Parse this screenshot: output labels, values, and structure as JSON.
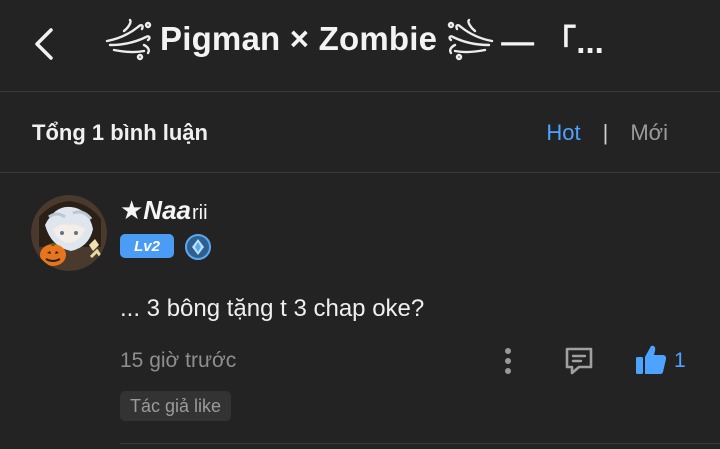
{
  "header": {
    "title": "Pigman × Zombie",
    "title_tail": "— 「...",
    "back_icon": "chevron-left-icon",
    "decor_icon": "swirl-ornament-icon"
  },
  "comments_bar": {
    "count_label": "Tổng 1 bình luận",
    "sort_hot": "Hot",
    "separator": "|",
    "sort_new": "Mới",
    "active_color": "#4da3ff"
  },
  "comment": {
    "user_name": "★Naa",
    "user_name_suffix": "rii",
    "level_badge": "Lv2",
    "level_color": "#4b9cf5",
    "verify_icon": "diamond-badge-icon",
    "text": "... 3 bông tặng t 3 chap oke?",
    "time": "15 giờ trước",
    "more_icon": "more-vertical-icon",
    "reply_icon": "comment-icon",
    "like_icon": "thumbs-up-icon",
    "like_count": "1",
    "author_tag": "Tác giả like"
  }
}
